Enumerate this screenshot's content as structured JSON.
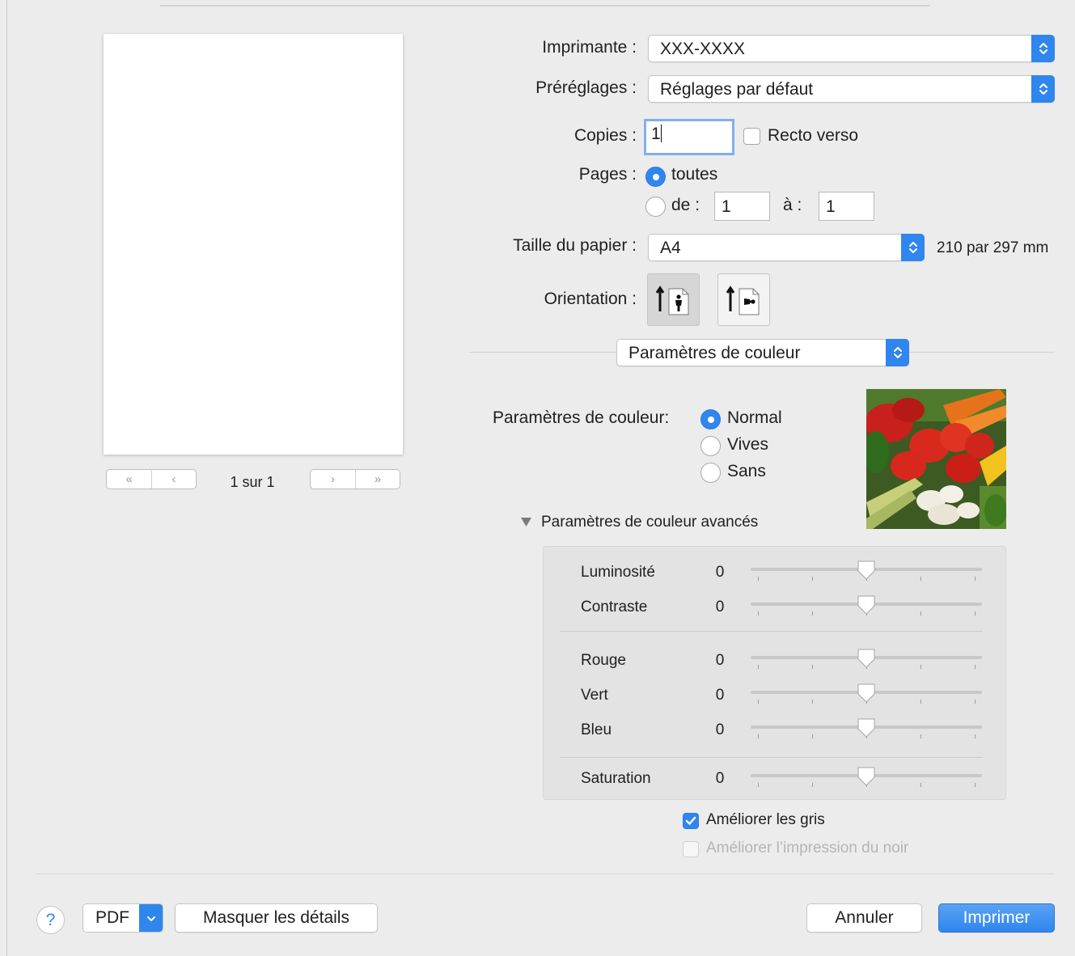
{
  "preview": {
    "page_indicator": "1 sur 1",
    "first_icon": "«",
    "prev_icon": "‹",
    "next_icon": "›",
    "last_icon": "»"
  },
  "printer": {
    "label": "Imprimante :",
    "value": "XXX-XXXX"
  },
  "presets": {
    "label": "Préréglages :",
    "value": "Réglages par défaut"
  },
  "copies": {
    "label": "Copies :",
    "value": "1",
    "duplex_label": "Recto verso",
    "duplex_checked": false
  },
  "pages": {
    "label": "Pages :",
    "all_label": "toutes",
    "from_label": "de :",
    "from_value": "1",
    "to_label": "à :",
    "to_value": "1"
  },
  "paper": {
    "label": "Taille du papier :",
    "value": "A4",
    "dimensions": "210 par 297 mm"
  },
  "orientation": {
    "label": "Orientation :",
    "selected": "portrait"
  },
  "panel_select": {
    "value": "Paramètres de couleur"
  },
  "color": {
    "label": "Paramètres de couleur:",
    "options": [
      "Normal",
      "Vives",
      "Sans"
    ],
    "selected": "Normal"
  },
  "advanced": {
    "toggle_label": "Paramètres de couleur avancés",
    "expanded": true,
    "sliders": [
      {
        "label": "Luminosité",
        "value": "0"
      },
      {
        "label": "Contraste",
        "value": "0"
      },
      {
        "label": "Rouge",
        "value": "0"
      },
      {
        "label": "Vert",
        "value": "0"
      },
      {
        "label": "Bleu",
        "value": "0"
      },
      {
        "label": "Saturation",
        "value": "0"
      }
    ],
    "improve_grays": {
      "label": "Améliorer les gris",
      "checked": true
    },
    "improve_black": {
      "label": "Améliorer l’impression du noir",
      "checked": false,
      "disabled": true
    }
  },
  "footer": {
    "help": "?",
    "pdf": "PDF",
    "hide_details": "Masquer les détails",
    "cancel": "Annuler",
    "print": "Imprimer"
  },
  "colors": {
    "accent": "#2f86ee",
    "background": "#ececec"
  }
}
